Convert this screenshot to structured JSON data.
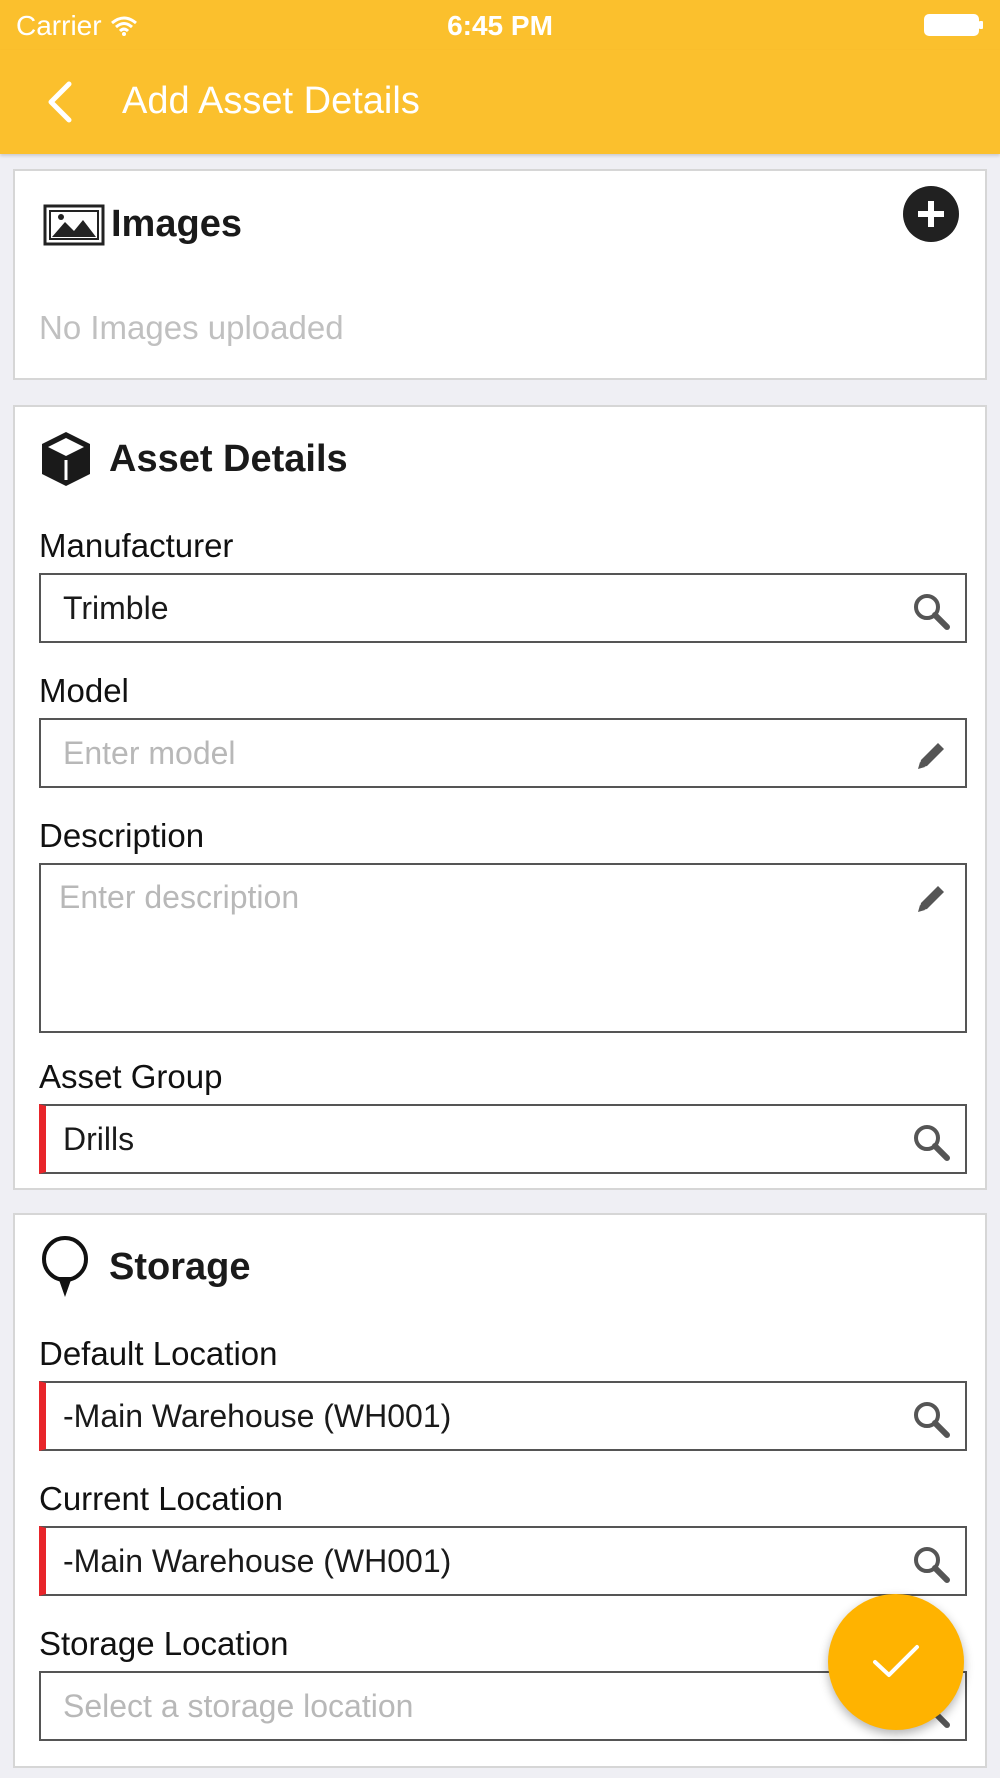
{
  "status_bar": {
    "carrier": "Carrier",
    "time": "6:45 PM"
  },
  "nav": {
    "title": "Add Asset Details"
  },
  "images_section": {
    "title": "Images",
    "empty_text": "No Images uploaded"
  },
  "asset_details": {
    "title": "Asset Details",
    "manufacturer": {
      "label": "Manufacturer",
      "value": "Trimble"
    },
    "model": {
      "label": "Model",
      "placeholder": "Enter model"
    },
    "description": {
      "label": "Description",
      "placeholder": "Enter description"
    },
    "asset_group": {
      "label": "Asset Group",
      "value": "Drills"
    }
  },
  "storage": {
    "title": "Storage",
    "default_location": {
      "label": "Default Location",
      "value": "-Main Warehouse (WH001)"
    },
    "current_location": {
      "label": "Current Location",
      "value": "-Main Warehouse (WH001)"
    },
    "storage_location": {
      "label": "Storage Location",
      "placeholder": "Select a storage location"
    }
  },
  "colors": {
    "accent": "#fbc02d",
    "fab": "#ffb300",
    "required": "#e8252a"
  }
}
